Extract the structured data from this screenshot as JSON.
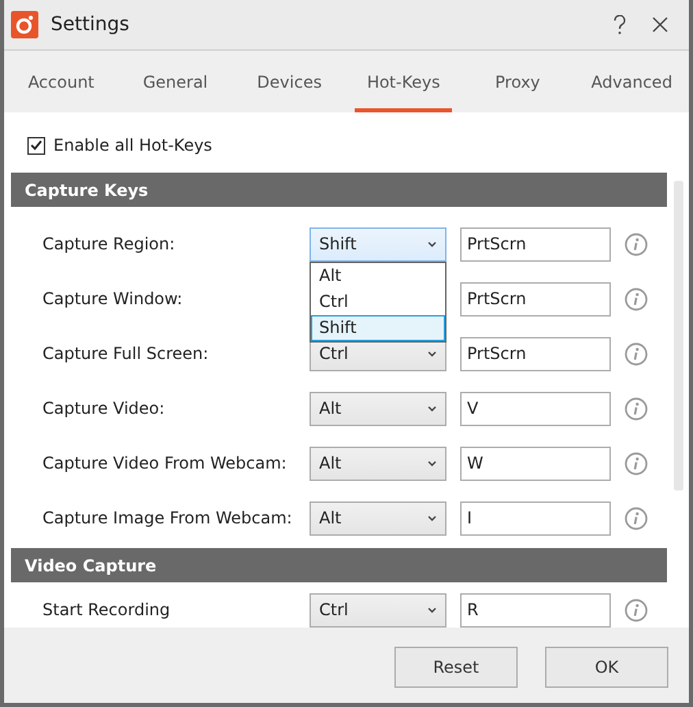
{
  "window": {
    "title": "Settings"
  },
  "tabs": [
    {
      "label": "Account",
      "selected": false
    },
    {
      "label": "General",
      "selected": false
    },
    {
      "label": "Devices",
      "selected": false
    },
    {
      "label": "Hot-Keys",
      "selected": true
    },
    {
      "label": "Proxy",
      "selected": false
    },
    {
      "label": "Advanced",
      "selected": false
    }
  ],
  "enable_all": {
    "label": "Enable all Hot-Keys",
    "checked": true
  },
  "sections": [
    {
      "title": "Capture Keys",
      "rows": [
        {
          "label": "Capture Region:",
          "modifier": "Shift",
          "key": "PrtScrn",
          "expanded": true,
          "options": [
            {
              "label": "Alt",
              "selected": false
            },
            {
              "label": "Ctrl",
              "selected": false
            },
            {
              "label": "Shift",
              "selected": true
            }
          ]
        },
        {
          "label": "Capture Window:",
          "key": "PrtScrn",
          "expanded": false
        },
        {
          "label": "Capture Full Screen:",
          "modifier": "Ctrl",
          "key": "PrtScrn",
          "expanded": false
        },
        {
          "label": "Capture Video:",
          "modifier": "Alt",
          "key": "V",
          "expanded": false
        },
        {
          "label": "Capture Video From Webcam:",
          "modifier": "Alt",
          "key": "W",
          "expanded": false
        },
        {
          "label": "Capture Image From Webcam:",
          "modifier": "Alt",
          "key": "I",
          "expanded": false
        }
      ]
    },
    {
      "title": "Video Capture",
      "rows": [
        {
          "label": "Start Recording",
          "modifier": "Ctrl",
          "key": "R",
          "expanded": false
        }
      ]
    }
  ],
  "buttons": [
    "Reset",
    "OK"
  ]
}
